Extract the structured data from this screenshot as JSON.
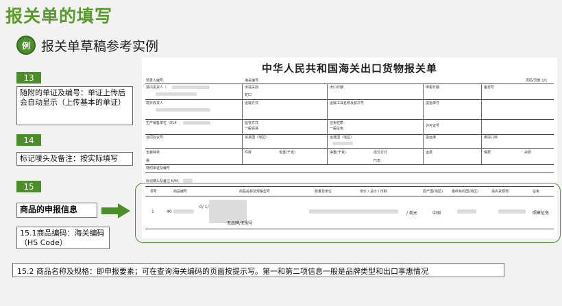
{
  "title": "报关单的填写",
  "subtitle": "报关单草稿参考实例",
  "icon_label": "例",
  "badges": [
    "13",
    "14",
    "15"
  ],
  "notes": {
    "n13": "随附的单证及编号：单证上传后会自动显示（上传基本的单证）",
    "n14": "标记唛头及备注：按实际填写",
    "n15_head": "商品的申报信息",
    "n15_1": "15.1商品编码：海关编码（HS Code）",
    "n15_2": "15.2 商品名称及规格：即申报要素；可在查询海关编码的页面按提示写。第一和第二项信息一般是品牌类型和出口享惠情况"
  },
  "doc": {
    "title": "中华人民共和国海关出口货物报关单",
    "pre_entry": "预录入编号:",
    "customs_no": "海关编号:",
    "page": "页码/页数:1/1",
    "fields": {
      "shipper": "境内发货人（",
      "exit_port": "出境关别",
      "exit_port_val": "蛇口",
      "exit_date": "出口日期",
      "declare_date": "申报日期",
      "record_no": "备案号",
      "consignee": "境外收货人",
      "transport": "运输方式",
      "vessel": "运输工具名称及航次号",
      "bl_no": "提运单号",
      "producer": "生产销售单位（914",
      "supervision": "监管方式",
      "supervision_val": "一般贸易",
      "levy": "征免性质",
      "levy_val": "一般征免",
      "license": "许可证号",
      "contract": "合同协议号",
      "trade_country": "贸易国（地区）",
      "dest_country": "运抵国（地区）",
      "dest_port": "指运港",
      "exit_port2": "离境口岸",
      "packing": "包装种类",
      "packing_val": "袋",
      "pieces": "件数",
      "gross": "毛重(千克)",
      "net": "净重(千克)",
      "deal_mode": "成交方式",
      "deal_val": "FOB",
      "freight": "运费",
      "insurance": "保费",
      "misc": "杂费",
      "docs": "随附单证及编号",
      "marks": "标记唛头及备注  N/M,"
    },
    "goods_headers": [
      "项号",
      "商品编号",
      "商品名称及规格型号",
      "数量及单位",
      "单价 / 总价 / 币制",
      "原产国(地区)",
      "最终目的国(地区)",
      "境内货源地",
      "征免"
    ],
    "goods_row": {
      "no": "1",
      "code": "40",
      "spec1": "0/ 1/",
      "spec2": "无品牌/无型号",
      "currency": "/ 美元",
      "origin": "中国",
      "levy": "照章征免"
    }
  }
}
